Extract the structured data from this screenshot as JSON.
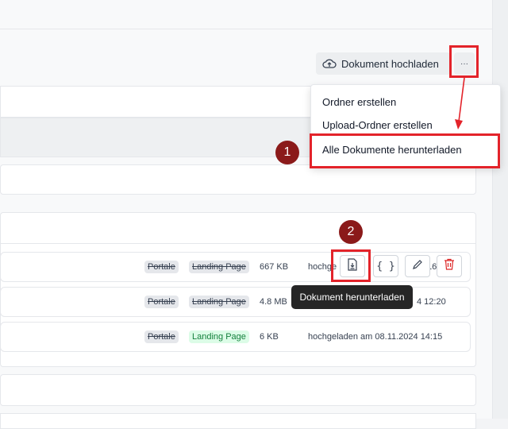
{
  "toolbar": {
    "upload_label": "Dokument hochladen",
    "more_label": "···"
  },
  "dropdown": {
    "items": [
      {
        "label": "Ordner erstellen"
      },
      {
        "label": "Upload-Ordner erstellen"
      },
      {
        "label": "Alle Dokumente herunterladen"
      }
    ]
  },
  "annotations": {
    "step1": "1",
    "step2": "2"
  },
  "tooltip": "Dokument herunterladen",
  "files": [
    {
      "tag1": "Portale",
      "tag2": "Landing Page",
      "tag2_active": false,
      "size": "667 KB",
      "info_start": "hochge",
      "info_end": "16"
    },
    {
      "tag1": "Portale",
      "tag2": "Landing Page",
      "tag2_active": false,
      "size": "4.8 MB",
      "info_end": "4 12:20"
    },
    {
      "tag1": "Portale",
      "tag2": "Landing Page",
      "tag2_active": true,
      "size": "6 KB",
      "info": "hochgeladen am 08.11.2024 14:15"
    }
  ],
  "colors": {
    "highlight": "#e3232a",
    "badge": "#8b1a1a",
    "tag_active_bg": "#dcfce7",
    "tag_active_text": "#15803d"
  }
}
